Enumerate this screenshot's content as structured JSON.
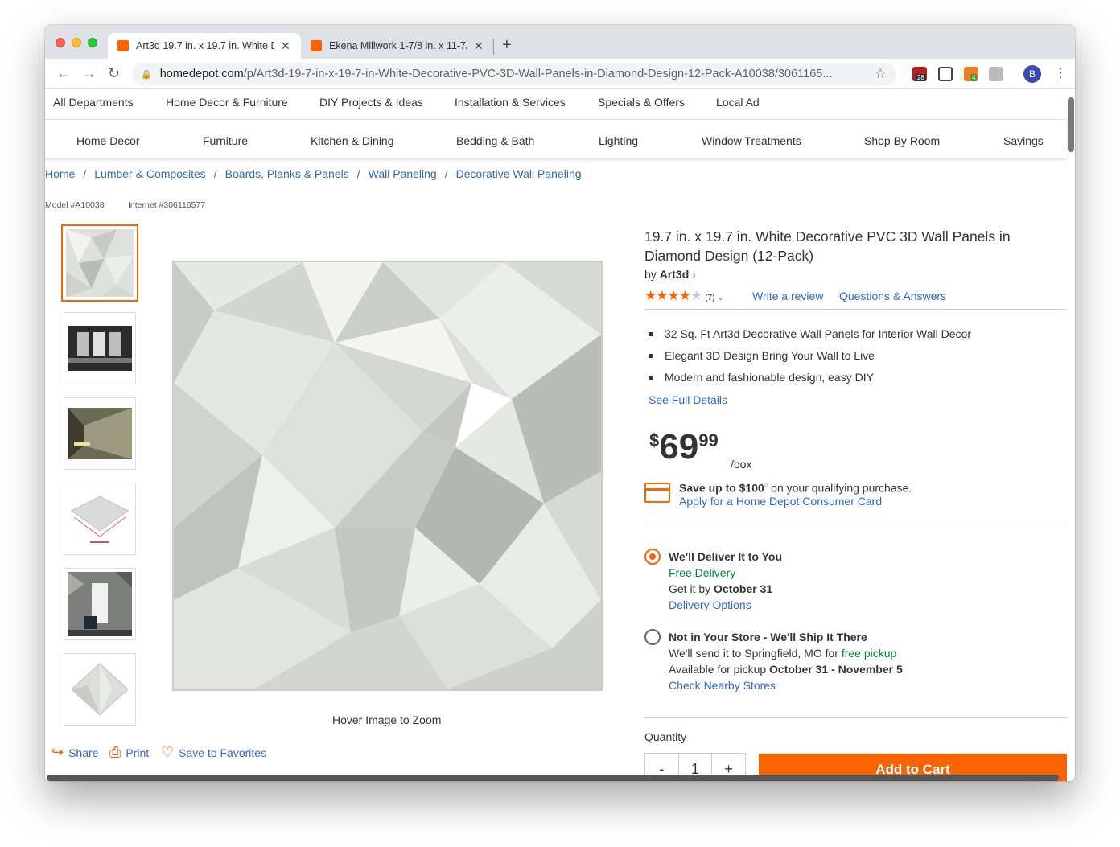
{
  "browser": {
    "tabs": [
      {
        "title": "Art3d 19.7 in. x 19.7 in. White D",
        "active": true
      },
      {
        "title": "Ekena Millwork 1-7/8 in. x 11-7/",
        "active": false
      }
    ],
    "new_tab": "+",
    "url_host": "homedepot.com",
    "url_path": "/p/Art3d-19-7-in-x-19-7-in-White-Decorative-PVC-3D-Wall-Panels-in-Diamond-Design-12-Pack-A10038/3061165...",
    "ext_badges": [
      "28",
      "4"
    ],
    "avatar": "B"
  },
  "topnav": [
    "All Departments",
    "Home Decor & Furniture",
    "DIY Projects & Ideas",
    "Installation & Services",
    "Specials & Offers",
    "Local Ad"
  ],
  "catnav": [
    "Home Decor",
    "Furniture",
    "Kitchen & Dining",
    "Bedding & Bath",
    "Lighting",
    "Window Treatments",
    "Shop By Room",
    "Savings"
  ],
  "breadcrumbs": [
    "Home",
    "Lumber & Composites",
    "Boards, Planks & Panels",
    "Wall Paneling",
    "Decorative Wall Paneling"
  ],
  "breadcrumb_sep": "/",
  "model": "Model #A10038",
  "internet": "Internet #306116577",
  "gallery": {
    "hover_text": "Hover Image to Zoom"
  },
  "actions": {
    "share": "Share",
    "print": "Print",
    "favorites": "Save to Favorites"
  },
  "product": {
    "title": "19.7 in. x 19.7 in. White Decorative PVC 3D Wall Panels in Diamond Design (12-Pack)",
    "by": "by",
    "brand": "Art3d",
    "rating": 4,
    "review_count": "(7)",
    "write_review": "Write a review",
    "qa": "Questions & Answers",
    "bullets": [
      "32 Sq. Ft Art3d Decorative Wall Panels for Interior Wall Decor",
      "Elegant 3D Design Bring Your Wall to Live",
      "Modern and fashionable design, easy DIY"
    ],
    "see_full": "See Full Details",
    "price_currency": "$",
    "price_whole": "69",
    "price_cents": "99",
    "price_unit": "/box",
    "save_bold": "Save up to $100",
    "save_mark": "◊",
    "save_rest": " on your qualifying purchase.",
    "apply_link": "Apply for a Home Depot Consumer Card"
  },
  "fulfillment": {
    "deliver_title": "We'll Deliver It to You",
    "deliver_free": "Free Delivery",
    "deliver_get": "Get it by ",
    "deliver_date": "October 31",
    "deliver_options": "Delivery Options",
    "ship_title": "Not in Your Store - We'll Ship It There",
    "ship_send": "We'll send it to Springfield, MO for ",
    "ship_free": "free pickup",
    "ship_avail": "Available for pickup ",
    "ship_dates": "October 31 - November 5",
    "ship_check": "Check Nearby Stores"
  },
  "purchase": {
    "quantity_label": "Quantity",
    "minus": "-",
    "qty": "1",
    "plus": "+",
    "add_to_cart": "Add to Cart"
  },
  "colors": {
    "accent": "#f96302",
    "link": "#3366cc",
    "green": "#00873c"
  }
}
